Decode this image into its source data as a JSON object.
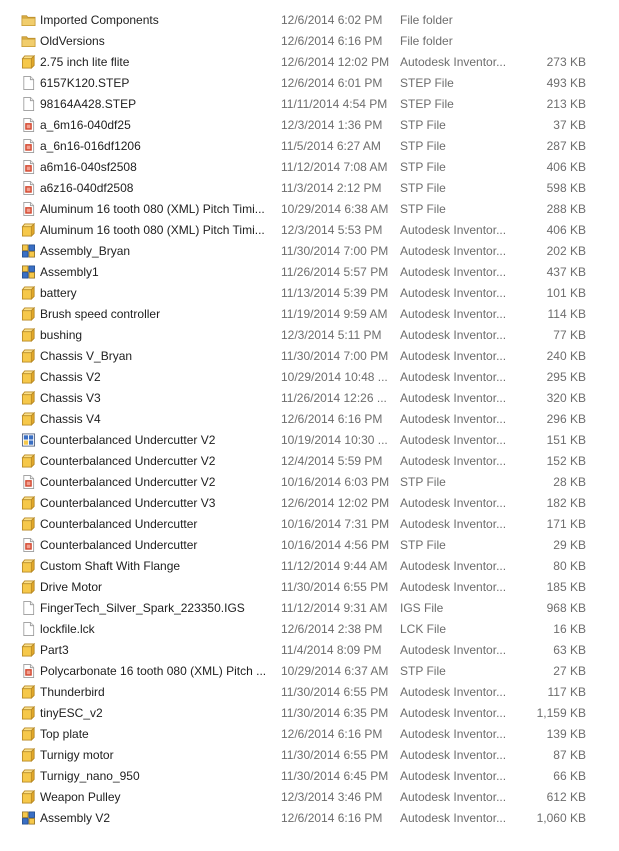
{
  "files": [
    {
      "name": "Imported Components",
      "date": "12/6/2014 6:02 PM",
      "type": "File folder",
      "size": "",
      "icon": "folder-icon"
    },
    {
      "name": "OldVersions",
      "date": "12/6/2014 6:16 PM",
      "type": "File folder",
      "size": "",
      "icon": "folder-icon"
    },
    {
      "name": "2.75 inch lite flite",
      "date": "12/6/2014 12:02 PM",
      "type": "Autodesk Inventor...",
      "size": "273 KB",
      "icon": "inventor-part-icon"
    },
    {
      "name": "6157K120.STEP",
      "date": "12/6/2014 6:01 PM",
      "type": "STEP File",
      "size": "493 KB",
      "icon": "blank-file-icon"
    },
    {
      "name": "98164A428.STEP",
      "date": "11/11/2014 4:54 PM",
      "type": "STEP File",
      "size": "213 KB",
      "icon": "blank-file-icon"
    },
    {
      "name": "a_6m16-040df25",
      "date": "12/3/2014 1:36 PM",
      "type": "STP File",
      "size": "37 KB",
      "icon": "stp-file-icon"
    },
    {
      "name": "a_6n16-016df1206",
      "date": "11/5/2014 6:27 AM",
      "type": "STP File",
      "size": "287 KB",
      "icon": "stp-file-icon"
    },
    {
      "name": "a6m16-040sf2508",
      "date": "11/12/2014 7:08 AM",
      "type": "STP File",
      "size": "406 KB",
      "icon": "stp-file-icon"
    },
    {
      "name": "a6z16-040df2508",
      "date": "11/3/2014 2:12 PM",
      "type": "STP File",
      "size": "598 KB",
      "icon": "stp-file-icon"
    },
    {
      "name": "Aluminum 16 tooth 080 (XML) Pitch Timi...",
      "date": "10/29/2014 6:38 AM",
      "type": "STP File",
      "size": "288 KB",
      "icon": "stp-file-icon"
    },
    {
      "name": "Aluminum 16 tooth 080 (XML) Pitch Timi...",
      "date": "12/3/2014 5:53 PM",
      "type": "Autodesk Inventor...",
      "size": "406 KB",
      "icon": "inventor-part-icon"
    },
    {
      "name": "Assembly_Bryan",
      "date": "11/30/2014 7:00 PM",
      "type": "Autodesk Inventor...",
      "size": "202 KB",
      "icon": "inventor-assembly-icon"
    },
    {
      "name": "Assembly1",
      "date": "11/26/2014 5:57 PM",
      "type": "Autodesk Inventor...",
      "size": "437 KB",
      "icon": "inventor-assembly-icon"
    },
    {
      "name": "battery",
      "date": "11/13/2014 5:39 PM",
      "type": "Autodesk Inventor...",
      "size": "101 KB",
      "icon": "inventor-part-icon"
    },
    {
      "name": "Brush speed controller",
      "date": "11/19/2014 9:59 AM",
      "type": "Autodesk Inventor...",
      "size": "114 KB",
      "icon": "inventor-part-icon"
    },
    {
      "name": "bushing",
      "date": "12/3/2014 5:11 PM",
      "type": "Autodesk Inventor...",
      "size": "77 KB",
      "icon": "inventor-part-icon"
    },
    {
      "name": "Chassis V_Bryan",
      "date": "11/30/2014 7:00 PM",
      "type": "Autodesk Inventor...",
      "size": "240 KB",
      "icon": "inventor-part-icon"
    },
    {
      "name": "Chassis V2",
      "date": "10/29/2014 10:48 ...",
      "type": "Autodesk Inventor...",
      "size": "295 KB",
      "icon": "inventor-part-icon"
    },
    {
      "name": "Chassis V3",
      "date": "11/26/2014 12:26 ...",
      "type": "Autodesk Inventor...",
      "size": "320 KB",
      "icon": "inventor-part-icon"
    },
    {
      "name": "Chassis V4",
      "date": "12/6/2014 6:16 PM",
      "type": "Autodesk Inventor...",
      "size": "296 KB",
      "icon": "inventor-part-icon"
    },
    {
      "name": "Counterbalanced Undercutter V2",
      "date": "10/19/2014 10:30 ...",
      "type": "Autodesk Inventor...",
      "size": "151 KB",
      "icon": "inventor-drawing-icon"
    },
    {
      "name": "Counterbalanced Undercutter V2",
      "date": "12/4/2014 5:59 PM",
      "type": "Autodesk Inventor...",
      "size": "152 KB",
      "icon": "inventor-part-icon"
    },
    {
      "name": "Counterbalanced Undercutter V2",
      "date": "10/16/2014 6:03 PM",
      "type": "STP File",
      "size": "28 KB",
      "icon": "stp-file-icon"
    },
    {
      "name": "Counterbalanced Undercutter V3",
      "date": "12/6/2014 12:02 PM",
      "type": "Autodesk Inventor...",
      "size": "182 KB",
      "icon": "inventor-part-icon"
    },
    {
      "name": "Counterbalanced Undercutter",
      "date": "10/16/2014 7:31 PM",
      "type": "Autodesk Inventor...",
      "size": "171 KB",
      "icon": "inventor-part-icon"
    },
    {
      "name": "Counterbalanced Undercutter",
      "date": "10/16/2014 4:56 PM",
      "type": "STP File",
      "size": "29 KB",
      "icon": "stp-file-icon"
    },
    {
      "name": "Custom Shaft With Flange",
      "date": "11/12/2014 9:44 AM",
      "type": "Autodesk Inventor...",
      "size": "80 KB",
      "icon": "inventor-part-icon"
    },
    {
      "name": "Drive Motor",
      "date": "11/30/2014 6:55 PM",
      "type": "Autodesk Inventor...",
      "size": "185 KB",
      "icon": "inventor-part-icon"
    },
    {
      "name": "FingerTech_Silver_Spark_223350.IGS",
      "date": "11/12/2014 9:31 AM",
      "type": "IGS File",
      "size": "968 KB",
      "icon": "blank-file-icon"
    },
    {
      "name": "lockfile.lck",
      "date": "12/6/2014 2:38 PM",
      "type": "LCK File",
      "size": "16 KB",
      "icon": "blank-file-icon"
    },
    {
      "name": "Part3",
      "date": "11/4/2014 8:09 PM",
      "type": "Autodesk Inventor...",
      "size": "63 KB",
      "icon": "inventor-part-icon"
    },
    {
      "name": "Polycarbonate 16 tooth 080 (XML) Pitch ...",
      "date": "10/29/2014 6:37 AM",
      "type": "STP File",
      "size": "27 KB",
      "icon": "stp-file-icon"
    },
    {
      "name": "Thunderbird",
      "date": "11/30/2014 6:55 PM",
      "type": "Autodesk Inventor...",
      "size": "117 KB",
      "icon": "inventor-part-icon"
    },
    {
      "name": "tinyESC_v2",
      "date": "11/30/2014 6:35 PM",
      "type": "Autodesk Inventor...",
      "size": "1,159 KB",
      "icon": "inventor-part-icon"
    },
    {
      "name": "Top plate",
      "date": "12/6/2014 6:16 PM",
      "type": "Autodesk Inventor...",
      "size": "139 KB",
      "icon": "inventor-part-icon"
    },
    {
      "name": "Turnigy motor",
      "date": "11/30/2014 6:55 PM",
      "type": "Autodesk Inventor...",
      "size": "87 KB",
      "icon": "inventor-part-icon"
    },
    {
      "name": "Turnigy_nano_950",
      "date": "11/30/2014 6:45 PM",
      "type": "Autodesk Inventor...",
      "size": "66 KB",
      "icon": "inventor-part-icon"
    },
    {
      "name": "Weapon Pulley",
      "date": "12/3/2014 3:46 PM",
      "type": "Autodesk Inventor...",
      "size": "612 KB",
      "icon": "inventor-part-icon"
    },
    {
      "name": "Assembly V2",
      "date": "12/6/2014 6:16 PM",
      "type": "Autodesk Inventor...",
      "size": "1,060 KB",
      "icon": "inventor-assembly-icon"
    }
  ]
}
